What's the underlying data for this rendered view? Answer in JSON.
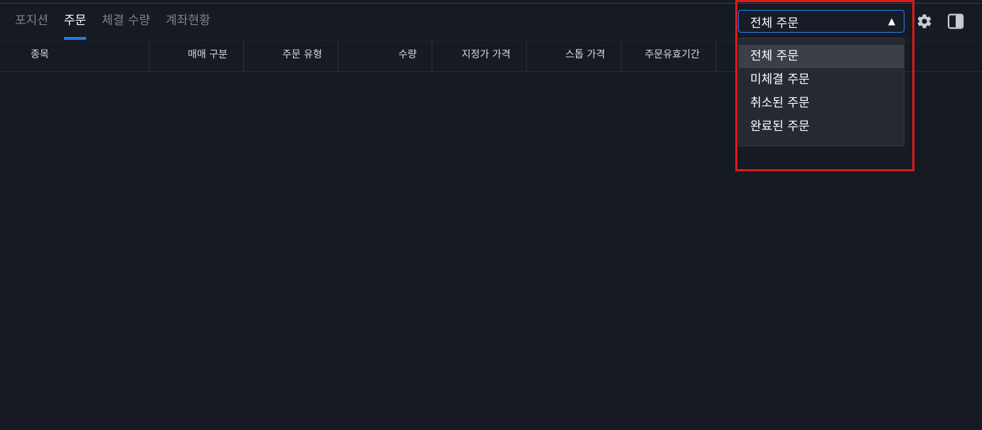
{
  "tabs": [
    {
      "label": "포지션",
      "active": false
    },
    {
      "label": "주문",
      "active": true
    },
    {
      "label": "체결 수량",
      "active": false
    },
    {
      "label": "계좌현황",
      "active": false
    }
  ],
  "columns": [
    "종목",
    "매매 구분",
    "주문 유형",
    "수량",
    "지정가 가격",
    "스톱 가격",
    "주문유효기간"
  ],
  "filter": {
    "selected": "전체 주문",
    "arrow": "▲",
    "options": [
      "전체 주문",
      "미체결 주문",
      "취소된 주문",
      "완료된 주문"
    ]
  },
  "icons": {
    "settings": "gear-icon",
    "panel": "panel-layout-icon"
  },
  "colors": {
    "background": "#151a23",
    "accent": "#1e7bf0",
    "highlight": "#e01919"
  }
}
